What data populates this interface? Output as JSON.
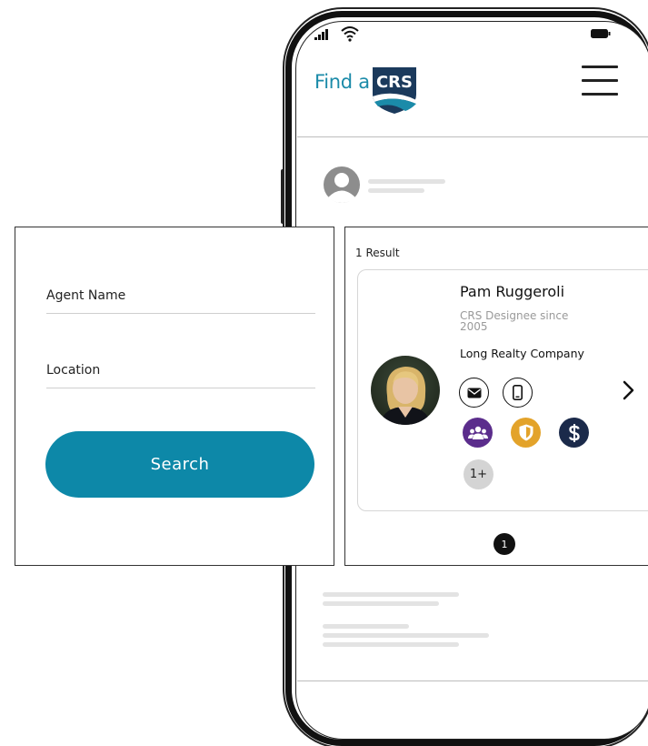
{
  "brand": {
    "prefix": "Find a",
    "logo_text": "CRS",
    "logo_color": "#1b3a5c",
    "accent": "#1b8ba9"
  },
  "search": {
    "agent_name_label": "Agent Name",
    "location_label": "Location",
    "button_label": "Search",
    "button_color": "#0d88a8"
  },
  "results": {
    "count_label": "1 Result",
    "agent": {
      "name": "Pam Ruggeroli",
      "designee_since": "CRS Designee since 2005",
      "company": "Long Realty Company",
      "more_badges": "1+",
      "contact_icons": [
        "mail-icon",
        "phone-icon"
      ],
      "badge_icons": [
        {
          "icon": "group-icon",
          "color": "#5b2d8c"
        },
        {
          "icon": "shield-icon",
          "color": "#e3a32a"
        },
        {
          "icon": "dollar-icon",
          "color": "#1b2a4a"
        }
      ]
    },
    "page": "1"
  }
}
